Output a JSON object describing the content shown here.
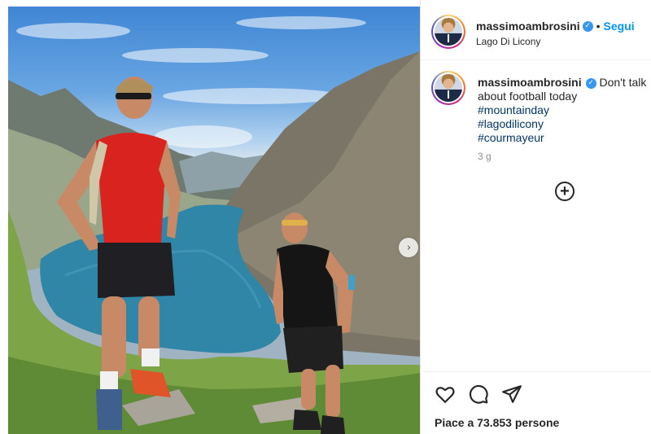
{
  "post": {
    "author": {
      "username": "massimoambrosini",
      "verified_icon": "verified-badge-icon",
      "follow_label": "Segui",
      "separator": "•",
      "location": "Lago Di Licony"
    },
    "caption": {
      "username": "massimoambrosini",
      "text": "Don't talk about football today",
      "hashtags": [
        "#mountainday",
        "#lagodilicony",
        "#courmayeur"
      ],
      "time_ago": "3 g"
    },
    "add_comment_icon": "plus-circle-icon",
    "actions": {
      "icons": [
        "heart-icon",
        "comment-icon",
        "share-icon"
      ],
      "likes_text": "Piace a 73.853 persone"
    },
    "carousel": {
      "next_icon": "chevron-right-icon",
      "next_glyph": "›"
    }
  },
  "colors": {
    "follow": "#0095f6",
    "verified": "#3897f0",
    "hashtag": "#00376b",
    "muted": "#8e8e8e"
  }
}
